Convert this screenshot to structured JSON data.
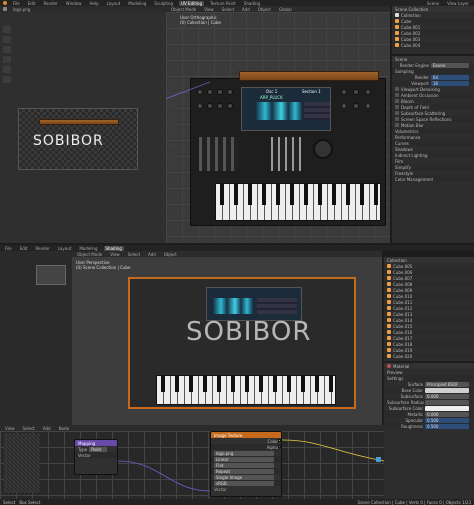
{
  "top": {
    "menus": [
      "File",
      "Edit",
      "Render",
      "Window",
      "Help"
    ],
    "workspace_tabs": [
      "Layout",
      "Modeling",
      "Sculpting",
      "UV Editing",
      "Texture Paint",
      "Shading"
    ],
    "active_tab": "UV Editing",
    "scene_name": "Scene",
    "view_layer": "View Layer"
  },
  "image_editor": {
    "title": "SOBIBOR",
    "image_name": "logo.png"
  },
  "viewport_top": {
    "header": [
      "Object Mode",
      "View",
      "Select",
      "Add",
      "Object"
    ],
    "info_lines": [
      "User Orthographic",
      "(0) Collection | Cube"
    ],
    "transform": "Global"
  },
  "synth": {
    "screen_title": "Osc 1",
    "section_label": "Section 1",
    "preset_label": "ARP_PLUCK",
    "brand_logo": "SOBIBOR"
  },
  "outliner": {
    "header": "Scene Collection",
    "items": [
      {
        "name": "Collection",
        "color": "#e0e0e0"
      },
      {
        "name": "Cube",
        "color": "#f0a040"
      },
      {
        "name": "Cube.001",
        "color": "#f0a040"
      },
      {
        "name": "Cube.002",
        "color": "#f0a040"
      },
      {
        "name": "Cube.003",
        "color": "#f0a040"
      },
      {
        "name": "Cube.004",
        "color": "#f0a040"
      }
    ]
  },
  "properties_top": {
    "header": "Scene",
    "render_engine_label": "Render Engine",
    "render_engine": "Eevee",
    "sampling_label": "Sampling",
    "render_label": "Render",
    "render_value": "64",
    "viewport_label": "Viewport",
    "viewport_value": "16",
    "viewport_denoising": "Viewport Denoising",
    "sections": [
      "Ambient Occlusion",
      "Bloom",
      "Depth of Field",
      "Subsurface Scattering",
      "Screen Space Reflections",
      "Motion Blur",
      "Volumetrics",
      "Performance",
      "Curves",
      "Shadows",
      "Indirect Lighting",
      "Film",
      "Simplify",
      "Freestyle",
      "Color Management"
    ]
  },
  "viewport_bottom": {
    "header": [
      "Object Mode",
      "View",
      "Select",
      "Add",
      "Object"
    ],
    "info_lines": [
      "User Perspective",
      "(0) Scene Collection | Cube"
    ]
  },
  "outliner_bottom": {
    "header": "Collection",
    "items": [
      "Cube.005",
      "Cube.006",
      "Cube.007",
      "Cube.008",
      "Cube.009",
      "Cube.010",
      "Cube.011",
      "Cube.012",
      "Cube.013",
      "Cube.014",
      "Cube.015",
      "Cube.016",
      "Cube.017",
      "Cube.018",
      "Cube.019",
      "Cube.020"
    ]
  },
  "material": {
    "header": "Material",
    "surface_label": "Surface",
    "surface_value": "Principled BSDF",
    "base_color_label": "Base Color",
    "subsurface_label": "Subsurface",
    "subsurface_value": "0.000",
    "subsurface_radius_label": "Subsurface Radius",
    "subsurface_color_label": "Subsurface Color",
    "metallic_label": "Metallic",
    "metallic_value": "0.000",
    "specular_label": "Specular",
    "specular_value": "0.500",
    "roughness_label": "Roughness",
    "roughness_value": "0.500",
    "preview_label": "Preview",
    "settings_label": "Settings"
  },
  "node_editor": {
    "header": [
      "View",
      "Select",
      "Add",
      "Node"
    ],
    "mapping_node": {
      "title": "Mapping",
      "type_label": "Type",
      "type_value": "Point",
      "vector_label": "Vector"
    },
    "image_node": {
      "title": "Image Texture",
      "image": "logo.png",
      "interp": "Linear",
      "proj": "Flat",
      "ext": "Repeat",
      "source": "Single Image",
      "color_space": "sRGB",
      "color_out": "Color",
      "alpha_out": "Alpha"
    },
    "vector_socket": "Vector"
  },
  "status_bar": {
    "left": "Select",
    "middle": "Box Select",
    "right": "Scene Collection | Cube | Verts 0 | Faces 0 | Objects 1/23"
  },
  "colors": {
    "accent": "#e08a2a",
    "selection": "#2e4e7a",
    "header_node_purple": "#6a4aa8",
    "header_node_orange": "#c56a1c",
    "waveform": "#3fd0e6"
  }
}
